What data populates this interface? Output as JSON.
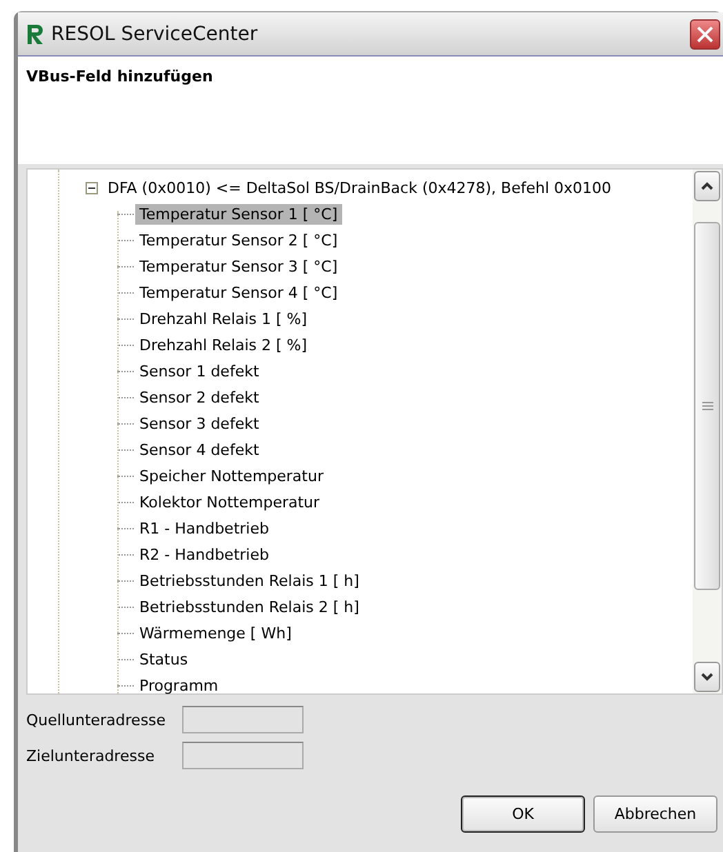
{
  "window": {
    "title": "RESOL ServiceCenter"
  },
  "header": {
    "title": "VBus-Feld hinzufügen"
  },
  "tree": {
    "items": [
      {
        "label": "DFA (0x0010) <= DeltaSol BS/DrainBack (0x4278), Befehl 0x0100",
        "expanded": true,
        "selected": false,
        "children": [
          {
            "label": "Temperatur Sensor 1 [ °C]",
            "selected": true
          },
          {
            "label": "Temperatur Sensor 2 [ °C]",
            "selected": false
          },
          {
            "label": "Temperatur Sensor 3 [ °C]",
            "selected": false
          },
          {
            "label": "Temperatur Sensor 4 [ °C]",
            "selected": false
          },
          {
            "label": "Drehzahl Relais 1 [ %]",
            "selected": false
          },
          {
            "label": "Drehzahl Relais 2 [ %]",
            "selected": false
          },
          {
            "label": "Sensor 1 defekt",
            "selected": false
          },
          {
            "label": "Sensor 2 defekt",
            "selected": false
          },
          {
            "label": "Sensor 3 defekt",
            "selected": false
          },
          {
            "label": "Sensor 4 defekt",
            "selected": false
          },
          {
            "label": "Speicher Nottemperatur",
            "selected": false
          },
          {
            "label": "Kolektor Nottemperatur",
            "selected": false
          },
          {
            "label": "R1 - Handbetrieb",
            "selected": false
          },
          {
            "label": "R2 - Handbetrieb",
            "selected": false
          },
          {
            "label": "Betriebsstunden Relais 1 [ h]",
            "selected": false
          },
          {
            "label": "Betriebsstunden Relais 2 [ h]",
            "selected": false
          },
          {
            "label": "Wärmemenge [ Wh]",
            "selected": false
          },
          {
            "label": "Status",
            "selected": false
          },
          {
            "label": "Programm",
            "selected": false
          }
        ]
      }
    ]
  },
  "fields": [
    {
      "label": "Quellunteradresse",
      "disabled": true
    },
    {
      "label": "Zielunteradresse",
      "disabled": true
    }
  ],
  "buttons": [
    {
      "label": "OK",
      "kind": "default"
    },
    {
      "label": "Abbrechen",
      "kind": "normal"
    }
  ]
}
